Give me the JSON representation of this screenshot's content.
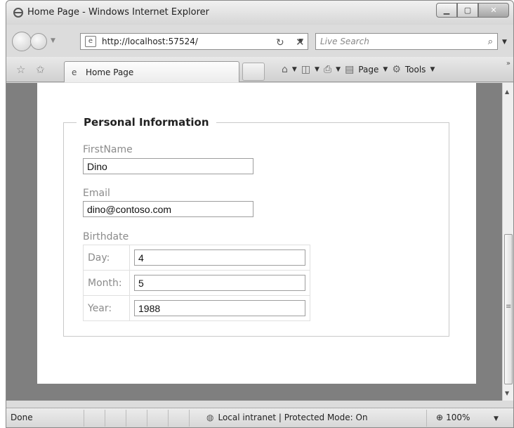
{
  "window": {
    "title": "Home Page - Windows Internet Explorer",
    "controls": [
      "minimize",
      "maximize",
      "close"
    ]
  },
  "address_bar": {
    "url": "http://localhost:57524/",
    "search_placeholder": "Live Search"
  },
  "tabs": [
    {
      "label": "Home Page",
      "active": true
    }
  ],
  "command_bar": {
    "page_label": "Page",
    "tools_label": "Tools"
  },
  "form": {
    "legend": "Personal Information",
    "first_name": {
      "label": "FirstName",
      "value": "Dino"
    },
    "email": {
      "label": "Email",
      "value": "dino@contoso.com"
    },
    "birthdate": {
      "label": "Birthdate",
      "rows": [
        {
          "label": "Day:",
          "value": "4"
        },
        {
          "label": "Month:",
          "value": "5"
        },
        {
          "label": "Year:",
          "value": "1988"
        }
      ]
    }
  },
  "status_bar": {
    "status": "Done",
    "zone": "Local intranet | Protected Mode: On",
    "zoom": "100%"
  }
}
